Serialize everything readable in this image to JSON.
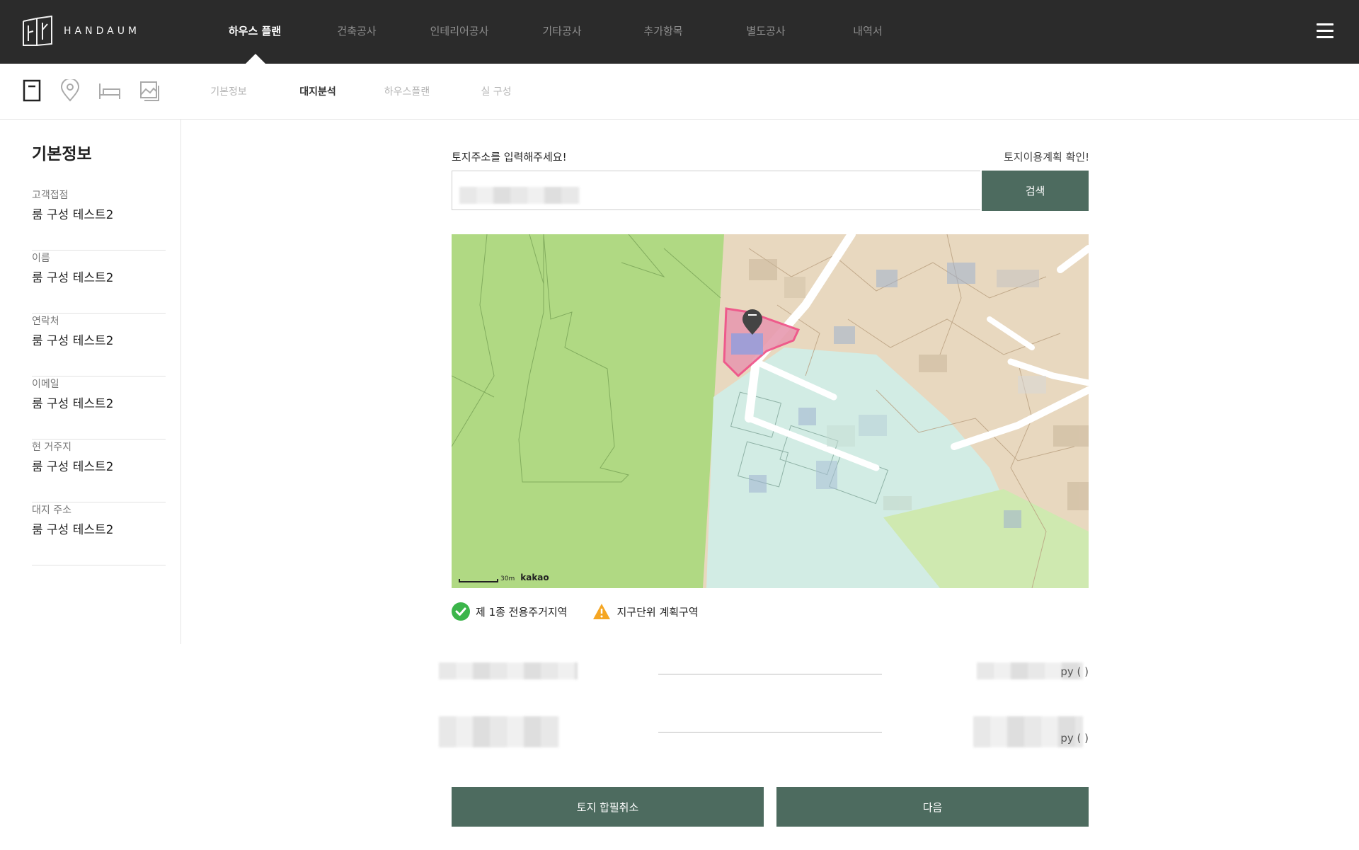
{
  "header": {
    "logo_text": "HANDAUM",
    "nav": [
      {
        "label": "하우스 플랜",
        "active": true
      },
      {
        "label": "건축공사",
        "active": false
      },
      {
        "label": "인테리어공사",
        "active": false
      },
      {
        "label": "기타공사",
        "active": false
      },
      {
        "label": "추가항목",
        "active": false
      },
      {
        "label": "별도공사",
        "active": false
      },
      {
        "label": "내역서",
        "active": false
      }
    ]
  },
  "subnav": {
    "icons": [
      "document-icon",
      "location-pin-icon",
      "bed-icon",
      "image-icon"
    ],
    "tabs": [
      {
        "label": "기본정보",
        "active": false
      },
      {
        "label": "대지분석",
        "active": true
      },
      {
        "label": "하우스플랜",
        "active": false
      },
      {
        "label": "실 구성",
        "active": false
      }
    ]
  },
  "sidebar": {
    "title": "기본정보",
    "fields": [
      {
        "label": "고객접점",
        "value": "룸 구성 테스트2"
      },
      {
        "label": "이름",
        "value": "룸 구성 테스트2"
      },
      {
        "label": "연락처",
        "value": "룸 구성 테스트2"
      },
      {
        "label": "이메일",
        "value": "룸 구성 테스트2"
      },
      {
        "label": "현 거주지",
        "value": "룸 구성 테스트2"
      },
      {
        "label": "대지 주소",
        "value": "룸 구성 테스트2"
      }
    ]
  },
  "main": {
    "address_label": "토지주소를 입력해주세요!",
    "land_use_link": "토지이용계획 확인!",
    "search_value": "",
    "search_button": "검색",
    "map": {
      "scale_label": "30m",
      "brand": "kakao"
    },
    "badges": [
      {
        "icon": "check-circle-icon",
        "text": "제 1종 전용주거지역",
        "color": "#3bb54a"
      },
      {
        "icon": "warning-triangle-icon",
        "text": "지구단위 계획구역",
        "color": "#f5a623"
      }
    ],
    "area_rows": [
      {
        "unit": "py (        )"
      },
      {
        "unit": "py (        )"
      }
    ],
    "buttons": {
      "cancel_merge": "토지 합필취소",
      "next": "다음"
    }
  },
  "colors": {
    "topbar": "#2b2b2b",
    "accent_green": "#4d6b5f",
    "map_park": "#b0d983",
    "map_residential": "#e8d8bf",
    "map_water": "#d2ece4",
    "parcel_highlight": "#f06a9a"
  }
}
